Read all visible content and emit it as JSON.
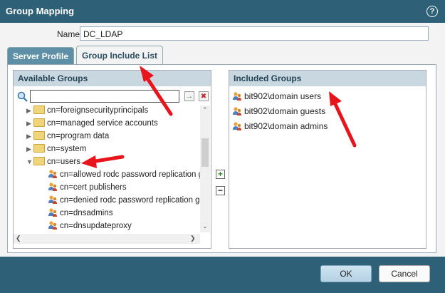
{
  "dialog": {
    "title": "Group Mapping",
    "help_icon": "?"
  },
  "name_field": {
    "label": "Name",
    "value": "DC_LDAP"
  },
  "tabs": [
    {
      "label": "Server Profile",
      "active": false
    },
    {
      "label": "Group Include List",
      "active": true
    }
  ],
  "available": {
    "header": "Available Groups",
    "search_value": "",
    "apply_icon": "→",
    "clear_icon": "✖",
    "folders": [
      {
        "label": "cn=foreignsecurityprincipals",
        "expanded": false
      },
      {
        "label": "cn=managed service accounts",
        "expanded": false
      },
      {
        "label": "cn=program data",
        "expanded": false
      },
      {
        "label": "cn=system",
        "expanded": false
      },
      {
        "label": "cn=users",
        "expanded": true
      }
    ],
    "groups": [
      "cn=allowed rodc password replication gro",
      "cn=cert publishers",
      "cn=denied rodc password replication gro",
      "cn=dnsadmins",
      "cn=dnsupdateproxy"
    ]
  },
  "actions": {
    "add": "+",
    "remove": "−"
  },
  "included": {
    "header": "Included Groups",
    "groups": [
      "bit902\\domain users",
      "bit902\\domain guests",
      "bit902\\domain admins"
    ]
  },
  "footer": {
    "ok": "OK",
    "cancel": "Cancel"
  },
  "colors": {
    "title_bar": "#2e6178",
    "panel_header": "#c9d7e0",
    "annotation_arrow": "#e8141c"
  }
}
